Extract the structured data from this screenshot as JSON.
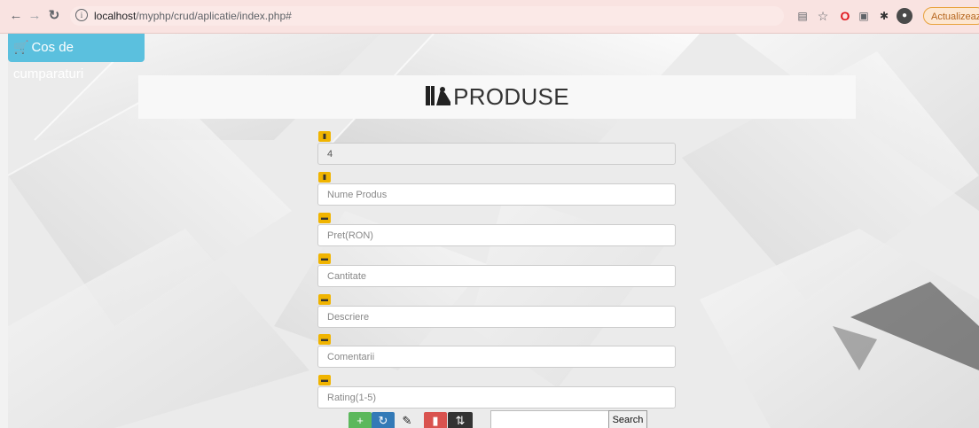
{
  "browser": {
    "url_host": "localhost",
    "url_path": "/myphp/crud/aplicatie/index.php#",
    "update_label": "Actualizează"
  },
  "cart": {
    "label": "Cos de cumparaturi"
  },
  "header": {
    "title": "PRODUSE"
  },
  "form": {
    "id_value": "4",
    "fields": [
      {
        "placeholder": "Nume Produs"
      },
      {
        "placeholder": "Pret(RON)"
      },
      {
        "placeholder": "Cantitate"
      },
      {
        "placeholder": "Descriere"
      },
      {
        "placeholder": "Comentarii"
      },
      {
        "placeholder": "Rating(1-5)"
      }
    ]
  },
  "actions": {
    "search_label": "Search",
    "search_value": ""
  },
  "colors": {
    "cart": "#5bc0de",
    "add": "#5cb85c",
    "refresh": "#337ab7",
    "delete": "#d9534f",
    "sort": "#333333",
    "field_icon": "#f0b400"
  }
}
